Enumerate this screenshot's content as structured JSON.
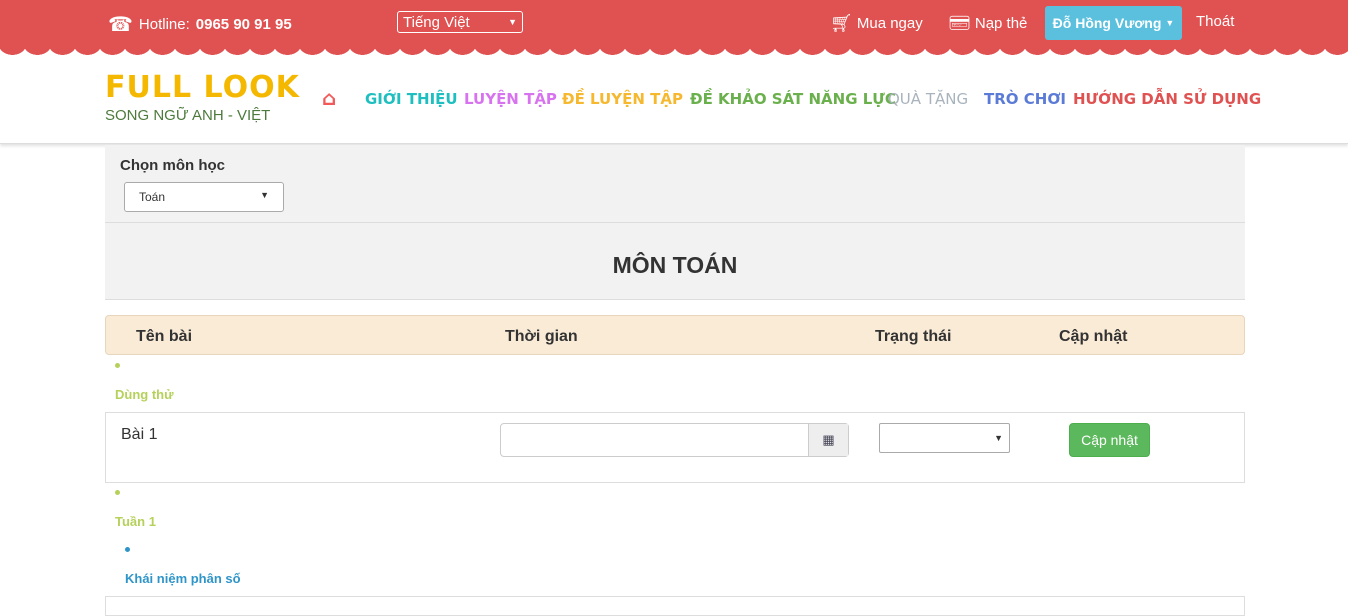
{
  "topbar": {
    "hotline_label": "Hotline:",
    "hotline_number": "0965 90 91 95",
    "language": "Tiếng Việt",
    "buy": "Mua ngay",
    "topup": "Nạp thẻ",
    "user": "Đỗ Hồng Vương",
    "logout": "Thoát",
    "color": "#e05252"
  },
  "logo": {
    "line1": "FULL LOOK",
    "line2": "SONG NGỮ ANH - VIỆT"
  },
  "nav": [
    {
      "label": "GIỚI THIỆU",
      "color": "#1fbfbf"
    },
    {
      "label": "LUYỆN TẬP",
      "color": "#d873f0"
    },
    {
      "label": "ĐỀ LUYỆN TẬP",
      "color": "#f5b82e"
    },
    {
      "label": "ĐỀ KHẢO SÁT NĂNG LỰC",
      "color": "#6ab04c"
    },
    {
      "label": "QUÀ TẶNG",
      "color": "#a8b3bd"
    },
    {
      "label": "TRÒ CHƠI",
      "color": "#5b7bd6"
    },
    {
      "label": "HƯỚNG DẪN SỬ DỤNG",
      "color": "#e05252"
    }
  ],
  "filter": {
    "label": "Chọn môn học",
    "value": "Toán"
  },
  "page_title": "MÔN TOÁN",
  "table": {
    "headers": [
      "Tên bài",
      "Thời gian",
      "Trạng thái",
      "Cập nhật"
    ]
  },
  "groups": [
    {
      "label": "Dùng thử",
      "color": "#b5d15a"
    },
    {
      "label": "Tuần 1",
      "color": "#b5d15a"
    },
    {
      "label": "Khái niệm phân số",
      "color": "#2f95c9"
    }
  ],
  "rows": [
    {
      "name": "Bài 1",
      "time": "",
      "status": "",
      "button": "Cập nhật"
    }
  ]
}
